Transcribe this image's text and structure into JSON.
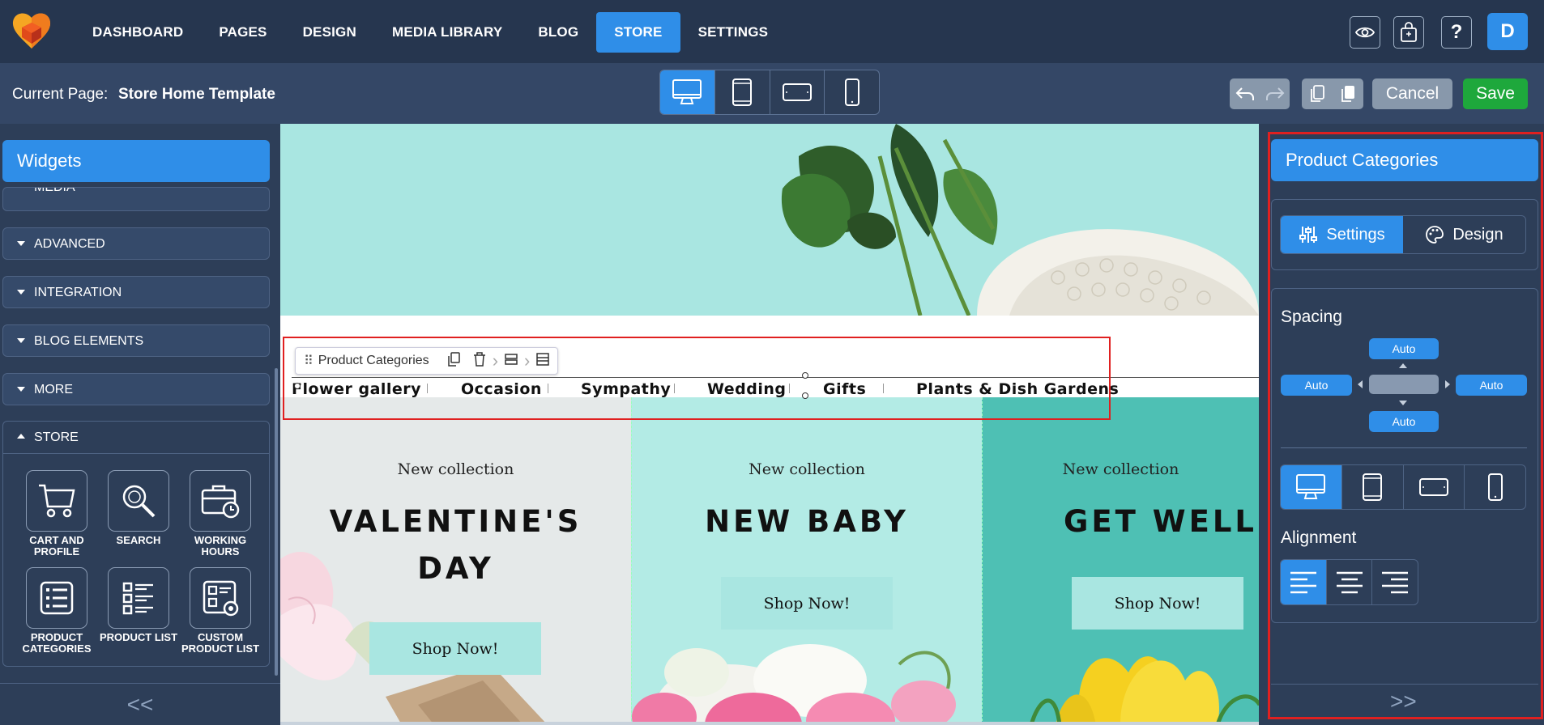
{
  "nav": {
    "items": [
      "DASHBOARD",
      "PAGES",
      "DESIGN",
      "MEDIA LIBRARY",
      "BLOG",
      "STORE",
      "SETTINGS"
    ],
    "active": "STORE",
    "avatar_letter": "D"
  },
  "subbar": {
    "current_page_label": "Current Page:",
    "current_page_name": "Store Home Template",
    "cancel_label": "Cancel",
    "save_label": "Save"
  },
  "left_panel": {
    "title": "Widgets",
    "partial_section": "MEDIA",
    "sections": [
      "ADVANCED",
      "INTEGRATION",
      "BLOG ELEMENTS",
      "MORE"
    ],
    "store_section": "STORE",
    "store_widgets": [
      {
        "label": "CART AND PROFILE",
        "icon": "cart-icon"
      },
      {
        "label": "SEARCH",
        "icon": "search-icon"
      },
      {
        "label": "WORKING HOURS",
        "icon": "briefcase-clock-icon"
      },
      {
        "label": "PRODUCT CATEGORIES",
        "icon": "categories-icon"
      },
      {
        "label": "PRODUCT LIST",
        "icon": "product-list-icon"
      },
      {
        "label": "CUSTOM PRODUCT LIST",
        "icon": "custom-list-icon"
      }
    ],
    "collapse_label": "<<"
  },
  "canvas": {
    "toolbar_label": "Product Categories",
    "categories": [
      "Flower gallery",
      "Occasion",
      "Sympathy",
      "Wedding",
      "Gifts",
      "Plants & Dish Gardens"
    ],
    "cards": [
      {
        "eyebrow": "New collection",
        "title": "VALENTINE'S DAY",
        "button": "Shop Now!"
      },
      {
        "eyebrow": "New collection",
        "title": "NEW BABY",
        "button": "Shop Now!"
      },
      {
        "eyebrow": "New collection",
        "title": "GET WELL",
        "button": "Shop Now!"
      }
    ]
  },
  "right_panel": {
    "title": "Product Categories",
    "tabs": [
      "Settings",
      "Design"
    ],
    "active_tab": "Settings",
    "spacing_label": "Spacing",
    "spacing": {
      "top": "Auto",
      "left": "Auto",
      "right": "Auto",
      "bottom": "Auto"
    },
    "alignment_label": "Alignment",
    "active_alignment": "left",
    "expand_label": ">>"
  },
  "colors": {
    "accent": "#2f8ee8",
    "save": "#1ea83c",
    "highlight": "#e02020",
    "mint": "#a9e6e1"
  }
}
